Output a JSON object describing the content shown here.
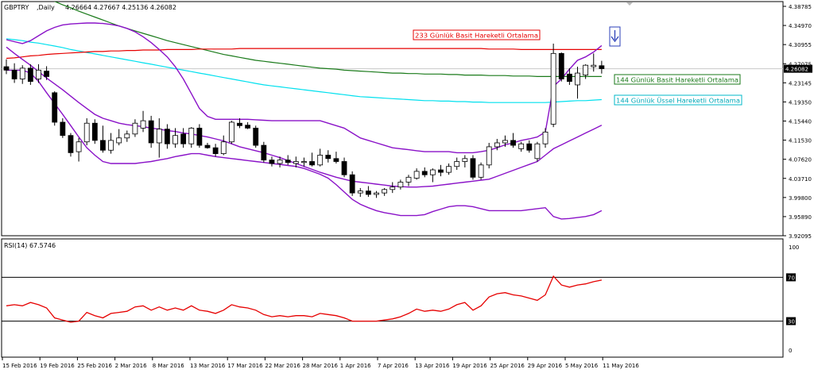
{
  "header": {
    "symbol": "GBPTRY",
    "timeframe": ",Daily",
    "ohlc": "4.26664 4.27667 4.25136 4.26082"
  },
  "colors": {
    "sma233": "#e60000",
    "sma144": "#1a7a1a",
    "ema144": "#00e0ee",
    "bollinger": "#8a12c8",
    "rsi": "#e60000",
    "candle_bull": "#ffffff",
    "candle_bear": "#000000"
  },
  "labels": {
    "sma233": "233 Günlük Basit Hareketli Ortalama",
    "sma144": "144 Günlük Basit Hareketli Ortalama",
    "ema144": "144 Günlük Üssel Hareketli Ortalama"
  },
  "price_axis": {
    "ticks": [
      "4.38785",
      "4.34970",
      "4.30955",
      "4.27075",
      "4.23145",
      "4.19350",
      "4.15440",
      "4.11530",
      "4.07620",
      "4.03710",
      "3.99800",
      "3.95890",
      "3.92095"
    ],
    "current": "4.26082"
  },
  "rsi_panel": {
    "title": "RSI(14) 67.5746",
    "ticks": [
      "100",
      "70",
      "30",
      "0"
    ]
  },
  "date_axis": [
    "15 Feb 2016",
    "19 Feb 2016",
    "25 Feb 2016",
    "2 Mar 2016",
    "8 Mar 2016",
    "13 Mar 2016",
    "17 Mar 2016",
    "22 Mar 2016",
    "28 Mar 2016",
    "1 Apr 2016",
    "7 Apr 2016",
    "13 Apr 2016",
    "19 Apr 2016",
    "25 Apr 2016",
    "29 Apr 2016",
    "5 May 2016",
    "11 May 2016"
  ],
  "chart_data": {
    "type": "candlestick",
    "ylim": [
      3.92095,
      4.38785
    ],
    "candles": [
      {
        "o": 4.265,
        "h": 4.28,
        "l": 4.25,
        "c": 4.258
      },
      {
        "o": 4.258,
        "h": 4.272,
        "l": 4.232,
        "c": 4.24
      },
      {
        "o": 4.24,
        "h": 4.268,
        "l": 4.23,
        "c": 4.262
      },
      {
        "o": 4.262,
        "h": 4.27,
        "l": 4.228,
        "c": 4.235
      },
      {
        "o": 4.24,
        "h": 4.27,
        "l": 4.232,
        "c": 4.258
      },
      {
        "o": 4.256,
        "h": 4.266,
        "l": 4.238,
        "c": 4.245
      },
      {
        "o": 4.212,
        "h": 4.215,
        "l": 4.145,
        "c": 4.152
      },
      {
        "o": 4.152,
        "h": 4.16,
        "l": 4.12,
        "c": 4.125
      },
      {
        "o": 4.125,
        "h": 4.13,
        "l": 4.082,
        "c": 4.09
      },
      {
        "o": 4.092,
        "h": 4.12,
        "l": 4.072,
        "c": 4.112
      },
      {
        "o": 4.112,
        "h": 4.16,
        "l": 4.105,
        "c": 4.15
      },
      {
        "o": 4.15,
        "h": 4.158,
        "l": 4.108,
        "c": 4.115
      },
      {
        "o": 4.115,
        "h": 4.145,
        "l": 4.09,
        "c": 4.095
      },
      {
        "o": 4.095,
        "h": 4.13,
        "l": 4.088,
        "c": 4.115
      },
      {
        "o": 4.11,
        "h": 4.138,
        "l": 4.105,
        "c": 4.12
      },
      {
        "o": 4.12,
        "h": 4.135,
        "l": 4.112,
        "c": 4.128
      },
      {
        "o": 4.128,
        "h": 4.158,
        "l": 4.122,
        "c": 4.15
      },
      {
        "o": 4.14,
        "h": 4.175,
        "l": 4.132,
        "c": 4.155
      },
      {
        "o": 4.155,
        "h": 4.165,
        "l": 4.1,
        "c": 4.11
      },
      {
        "o": 4.11,
        "h": 4.16,
        "l": 4.08,
        "c": 4.138
      },
      {
        "o": 4.138,
        "h": 4.148,
        "l": 4.098,
        "c": 4.108
      },
      {
        "o": 4.108,
        "h": 4.14,
        "l": 4.1,
        "c": 4.125
      },
      {
        "o": 4.128,
        "h": 4.14,
        "l": 4.1,
        "c": 4.108
      },
      {
        "o": 4.108,
        "h": 4.142,
        "l": 4.1,
        "c": 4.14
      },
      {
        "o": 4.14,
        "h": 4.148,
        "l": 4.1,
        "c": 4.105
      },
      {
        "o": 4.105,
        "h": 4.11,
        "l": 4.098,
        "c": 4.1
      },
      {
        "o": 4.1,
        "h": 4.108,
        "l": 4.082,
        "c": 4.088
      },
      {
        "o": 4.088,
        "h": 4.125,
        "l": 4.085,
        "c": 4.112
      },
      {
        "o": 4.112,
        "h": 4.155,
        "l": 4.108,
        "c": 4.152
      },
      {
        "o": 4.15,
        "h": 4.16,
        "l": 4.14,
        "c": 4.145
      },
      {
        "o": 4.146,
        "h": 4.152,
        "l": 4.138,
        "c": 4.14
      },
      {
        "o": 4.14,
        "h": 4.145,
        "l": 4.1,
        "c": 4.105
      },
      {
        "o": 4.105,
        "h": 4.112,
        "l": 4.07,
        "c": 4.075
      },
      {
        "o": 4.075,
        "h": 4.082,
        "l": 4.062,
        "c": 4.068
      },
      {
        "o": 4.068,
        "h": 4.082,
        "l": 4.06,
        "c": 4.075
      },
      {
        "o": 4.075,
        "h": 4.085,
        "l": 4.065,
        "c": 4.07
      },
      {
        "o": 4.068,
        "h": 4.082,
        "l": 4.06,
        "c": 4.072
      },
      {
        "o": 4.07,
        "h": 4.08,
        "l": 4.062,
        "c": 4.072
      },
      {
        "o": 4.072,
        "h": 4.09,
        "l": 4.062,
        "c": 4.065
      },
      {
        "o": 4.065,
        "h": 4.098,
        "l": 4.062,
        "c": 4.085
      },
      {
        "o": 4.085,
        "h": 4.095,
        "l": 4.07,
        "c": 4.078
      },
      {
        "o": 4.078,
        "h": 4.092,
        "l": 4.068,
        "c": 4.072
      },
      {
        "o": 4.072,
        "h": 4.08,
        "l": 4.04,
        "c": 4.045
      },
      {
        "o": 4.045,
        "h": 4.052,
        "l": 4.002,
        "c": 4.008
      },
      {
        "o": 4.008,
        "h": 4.018,
        "l": 4.0,
        "c": 4.012
      },
      {
        "o": 4.012,
        "h": 4.022,
        "l": 4.0,
        "c": 4.005
      },
      {
        "o": 4.005,
        "h": 4.012,
        "l": 3.998,
        "c": 4.008
      },
      {
        "o": 4.008,
        "h": 4.018,
        "l": 4.002,
        "c": 4.015
      },
      {
        "o": 4.015,
        "h": 4.03,
        "l": 4.008,
        "c": 4.02
      },
      {
        "o": 4.02,
        "h": 4.035,
        "l": 4.015,
        "c": 4.03
      },
      {
        "o": 4.03,
        "h": 4.045,
        "l": 4.022,
        "c": 4.04
      },
      {
        "o": 4.038,
        "h": 4.058,
        "l": 4.035,
        "c": 4.052
      },
      {
        "o": 4.052,
        "h": 4.06,
        "l": 4.04,
        "c": 4.045
      },
      {
        "o": 4.045,
        "h": 4.058,
        "l": 4.03,
        "c": 4.055
      },
      {
        "o": 4.055,
        "h": 4.065,
        "l": 4.042,
        "c": 4.05
      },
      {
        "o": 4.05,
        "h": 4.068,
        "l": 4.045,
        "c": 4.062
      },
      {
        "o": 4.062,
        "h": 4.08,
        "l": 4.055,
        "c": 4.072
      },
      {
        "o": 4.072,
        "h": 4.085,
        "l": 4.06,
        "c": 4.078
      },
      {
        "o": 4.078,
        "h": 4.085,
        "l": 4.035,
        "c": 4.04
      },
      {
        "o": 4.04,
        "h": 4.07,
        "l": 4.035,
        "c": 4.065
      },
      {
        "o": 4.065,
        "h": 4.11,
        "l": 4.058,
        "c": 4.102
      },
      {
        "o": 4.102,
        "h": 4.118,
        "l": 4.095,
        "c": 4.11
      },
      {
        "o": 4.11,
        "h": 4.125,
        "l": 4.102,
        "c": 4.115
      },
      {
        "o": 4.115,
        "h": 4.13,
        "l": 4.1,
        "c": 4.105
      },
      {
        "o": 4.098,
        "h": 4.112,
        "l": 4.092,
        "c": 4.108
      },
      {
        "o": 4.108,
        "h": 4.115,
        "l": 4.09,
        "c": 4.095
      },
      {
        "o": 4.078,
        "h": 4.112,
        "l": 4.072,
        "c": 4.108
      },
      {
        "o": 4.108,
        "h": 4.14,
        "l": 4.1,
        "c": 4.132
      },
      {
        "o": 4.148,
        "h": 4.312,
        "l": 4.142,
        "c": 4.292
      },
      {
        "o": 4.292,
        "h": 4.294,
        "l": 4.235,
        "c": 4.24
      },
      {
        "o": 4.25,
        "h": 4.262,
        "l": 4.228,
        "c": 4.235
      },
      {
        "o": 4.228,
        "h": 4.265,
        "l": 4.2,
        "c": 4.252
      },
      {
        "o": 4.248,
        "h": 4.27,
        "l": 4.24,
        "c": 4.268
      },
      {
        "o": 4.265,
        "h": 4.292,
        "l": 4.255,
        "c": 4.268
      },
      {
        "o": 4.267,
        "h": 4.277,
        "l": 4.251,
        "c": 4.261
      }
    ],
    "sma233": [
      4.282,
      4.283,
      4.285,
      4.287,
      4.288,
      4.29,
      4.291,
      4.292,
      4.293,
      4.294,
      4.295,
      4.296,
      4.296,
      4.297,
      4.297,
      4.298,
      4.298,
      4.299,
      4.299,
      4.299,
      4.3,
      4.3,
      4.3,
      4.3,
      4.301,
      4.301,
      4.301,
      4.301,
      4.301,
      4.302,
      4.302,
      4.302,
      4.302,
      4.302,
      4.302,
      4.302,
      4.302,
      4.302,
      4.302,
      4.302,
      4.302,
      4.302,
      4.302,
      4.302,
      4.302,
      4.302,
      4.302,
      4.302,
      4.302,
      4.302,
      4.302,
      4.302,
      4.302,
      4.302,
      4.302,
      4.302,
      4.302,
      4.302,
      4.302,
      4.302,
      4.301,
      4.301,
      4.301,
      4.301,
      4.3,
      4.3,
      4.3,
      4.3,
      4.3,
      4.3,
      4.3,
      4.3,
      4.3,
      4.3,
      4.3
    ],
    "sma144": [
      4.44,
      4.433,
      4.426,
      4.419,
      4.412,
      4.405,
      4.398,
      4.391,
      4.385,
      4.378,
      4.372,
      4.366,
      4.36,
      4.354,
      4.348,
      4.343,
      4.338,
      4.333,
      4.328,
      4.323,
      4.318,
      4.314,
      4.31,
      4.306,
      4.302,
      4.298,
      4.294,
      4.29,
      4.287,
      4.284,
      4.281,
      4.278,
      4.276,
      4.274,
      4.272,
      4.27,
      4.268,
      4.266,
      4.264,
      4.262,
      4.261,
      4.26,
      4.258,
      4.257,
      4.256,
      4.255,
      4.254,
      4.253,
      4.252,
      4.252,
      4.251,
      4.251,
      4.25,
      4.25,
      4.25,
      4.249,
      4.249,
      4.248,
      4.248,
      4.248,
      4.247,
      4.247,
      4.247,
      4.246,
      4.246,
      4.246,
      4.245,
      4.245,
      4.245,
      4.245,
      4.245,
      4.245,
      4.245,
      4.245,
      4.245
    ],
    "ema144": [
      4.322,
      4.32,
      4.318,
      4.315,
      4.313,
      4.31,
      4.307,
      4.304,
      4.3,
      4.297,
      4.294,
      4.291,
      4.288,
      4.285,
      4.282,
      4.279,
      4.276,
      4.273,
      4.27,
      4.267,
      4.264,
      4.261,
      4.258,
      4.255,
      4.252,
      4.249,
      4.246,
      4.243,
      4.24,
      4.237,
      4.234,
      4.231,
      4.228,
      4.226,
      4.224,
      4.222,
      4.22,
      4.218,
      4.216,
      4.214,
      4.212,
      4.21,
      4.208,
      4.206,
      4.204,
      4.203,
      4.202,
      4.201,
      4.2,
      4.199,
      4.198,
      4.197,
      4.196,
      4.196,
      4.195,
      4.195,
      4.194,
      4.194,
      4.193,
      4.193,
      4.192,
      4.192,
      4.192,
      4.192,
      4.192,
      4.192,
      4.192,
      4.192,
      4.193,
      4.194,
      4.195,
      4.196,
      4.196,
      4.197,
      4.198
    ],
    "bollinger": {
      "upper": [
        4.32,
        4.316,
        4.312,
        4.318,
        4.328,
        4.338,
        4.345,
        4.35,
        4.352,
        4.353,
        4.354,
        4.354,
        4.353,
        4.351,
        4.348,
        4.343,
        4.336,
        4.326,
        4.314,
        4.3,
        4.285,
        4.265,
        4.24,
        4.21,
        4.18,
        4.164,
        4.158,
        4.158,
        4.158,
        4.158,
        4.158,
        4.157,
        4.156,
        4.155,
        4.155,
        4.155,
        4.155,
        4.155,
        4.155,
        4.155,
        4.15,
        4.145,
        4.14,
        4.13,
        4.12,
        4.115,
        4.11,
        4.105,
        4.1,
        4.098,
        4.096,
        4.094,
        4.092,
        4.092,
        4.092,
        4.092,
        4.09,
        4.09,
        4.09,
        4.092,
        4.095,
        4.1,
        4.106,
        4.11,
        4.115,
        4.118,
        4.122,
        4.132,
        4.225,
        4.24,
        4.26,
        4.278,
        4.285,
        4.295,
        4.308
      ],
      "middle": [
        4.305,
        4.292,
        4.28,
        4.268,
        4.255,
        4.242,
        4.23,
        4.218,
        4.205,
        4.192,
        4.18,
        4.168,
        4.16,
        4.155,
        4.15,
        4.147,
        4.145,
        4.143,
        4.14,
        4.138,
        4.135,
        4.133,
        4.13,
        4.128,
        4.125,
        4.122,
        4.118,
        4.114,
        4.108,
        4.102,
        4.098,
        4.094,
        4.09,
        4.085,
        4.08,
        4.074,
        4.068,
        4.062,
        4.056,
        4.05,
        4.045,
        4.04,
        4.036,
        4.032,
        4.03,
        4.028,
        4.026,
        4.024,
        4.022,
        4.021,
        4.02,
        4.02,
        4.021,
        4.022,
        4.024,
        4.026,
        4.028,
        4.03,
        4.032,
        4.034,
        4.036,
        4.042,
        4.048,
        4.054,
        4.06,
        4.066,
        4.072,
        4.085,
        4.098,
        4.106,
        4.114,
        4.122,
        4.13,
        4.138,
        4.146
      ],
      "lower": [
        4.258,
        4.258,
        4.258,
        4.252,
        4.235,
        4.212,
        4.19,
        4.168,
        4.145,
        4.122,
        4.1,
        4.085,
        4.072,
        4.068,
        4.068,
        4.068,
        4.068,
        4.07,
        4.072,
        4.075,
        4.078,
        4.082,
        4.085,
        4.088,
        4.088,
        4.085,
        4.082,
        4.08,
        4.078,
        4.076,
        4.074,
        4.072,
        4.07,
        4.068,
        4.066,
        4.064,
        4.062,
        4.058,
        4.052,
        4.046,
        4.038,
        4.025,
        4.01,
        3.995,
        3.985,
        3.978,
        3.972,
        3.968,
        3.965,
        3.962,
        3.962,
        3.962,
        3.964,
        3.97,
        3.975,
        3.98,
        3.982,
        3.982,
        3.98,
        3.976,
        3.972,
        3.972,
        3.972,
        3.972,
        3.972,
        3.974,
        3.976,
        3.978,
        3.96,
        3.955,
        3.956,
        3.958,
        3.96,
        3.964,
        3.972
      ]
    },
    "rsi": [
      44,
      45,
      44,
      47,
      45,
      42,
      33,
      31,
      29,
      30,
      38,
      35,
      33,
      37,
      38,
      39,
      43,
      44,
      40,
      43,
      40,
      42,
      40,
      44,
      40,
      39,
      37,
      40,
      45,
      43,
      42,
      40,
      36,
      34,
      35,
      34,
      35,
      35,
      34,
      37,
      36,
      35,
      33,
      30,
      30,
      30,
      30,
      31,
      32,
      34,
      37,
      41,
      39,
      40,
      39,
      41,
      45,
      47,
      40,
      44,
      52,
      55,
      56,
      54,
      53,
      51,
      49,
      54,
      71,
      63,
      61,
      63,
      64,
      66,
      67.5
    ],
    "rsi_ylim": [
      0,
      100
    ],
    "rsi_levels": [
      70,
      30
    ]
  }
}
